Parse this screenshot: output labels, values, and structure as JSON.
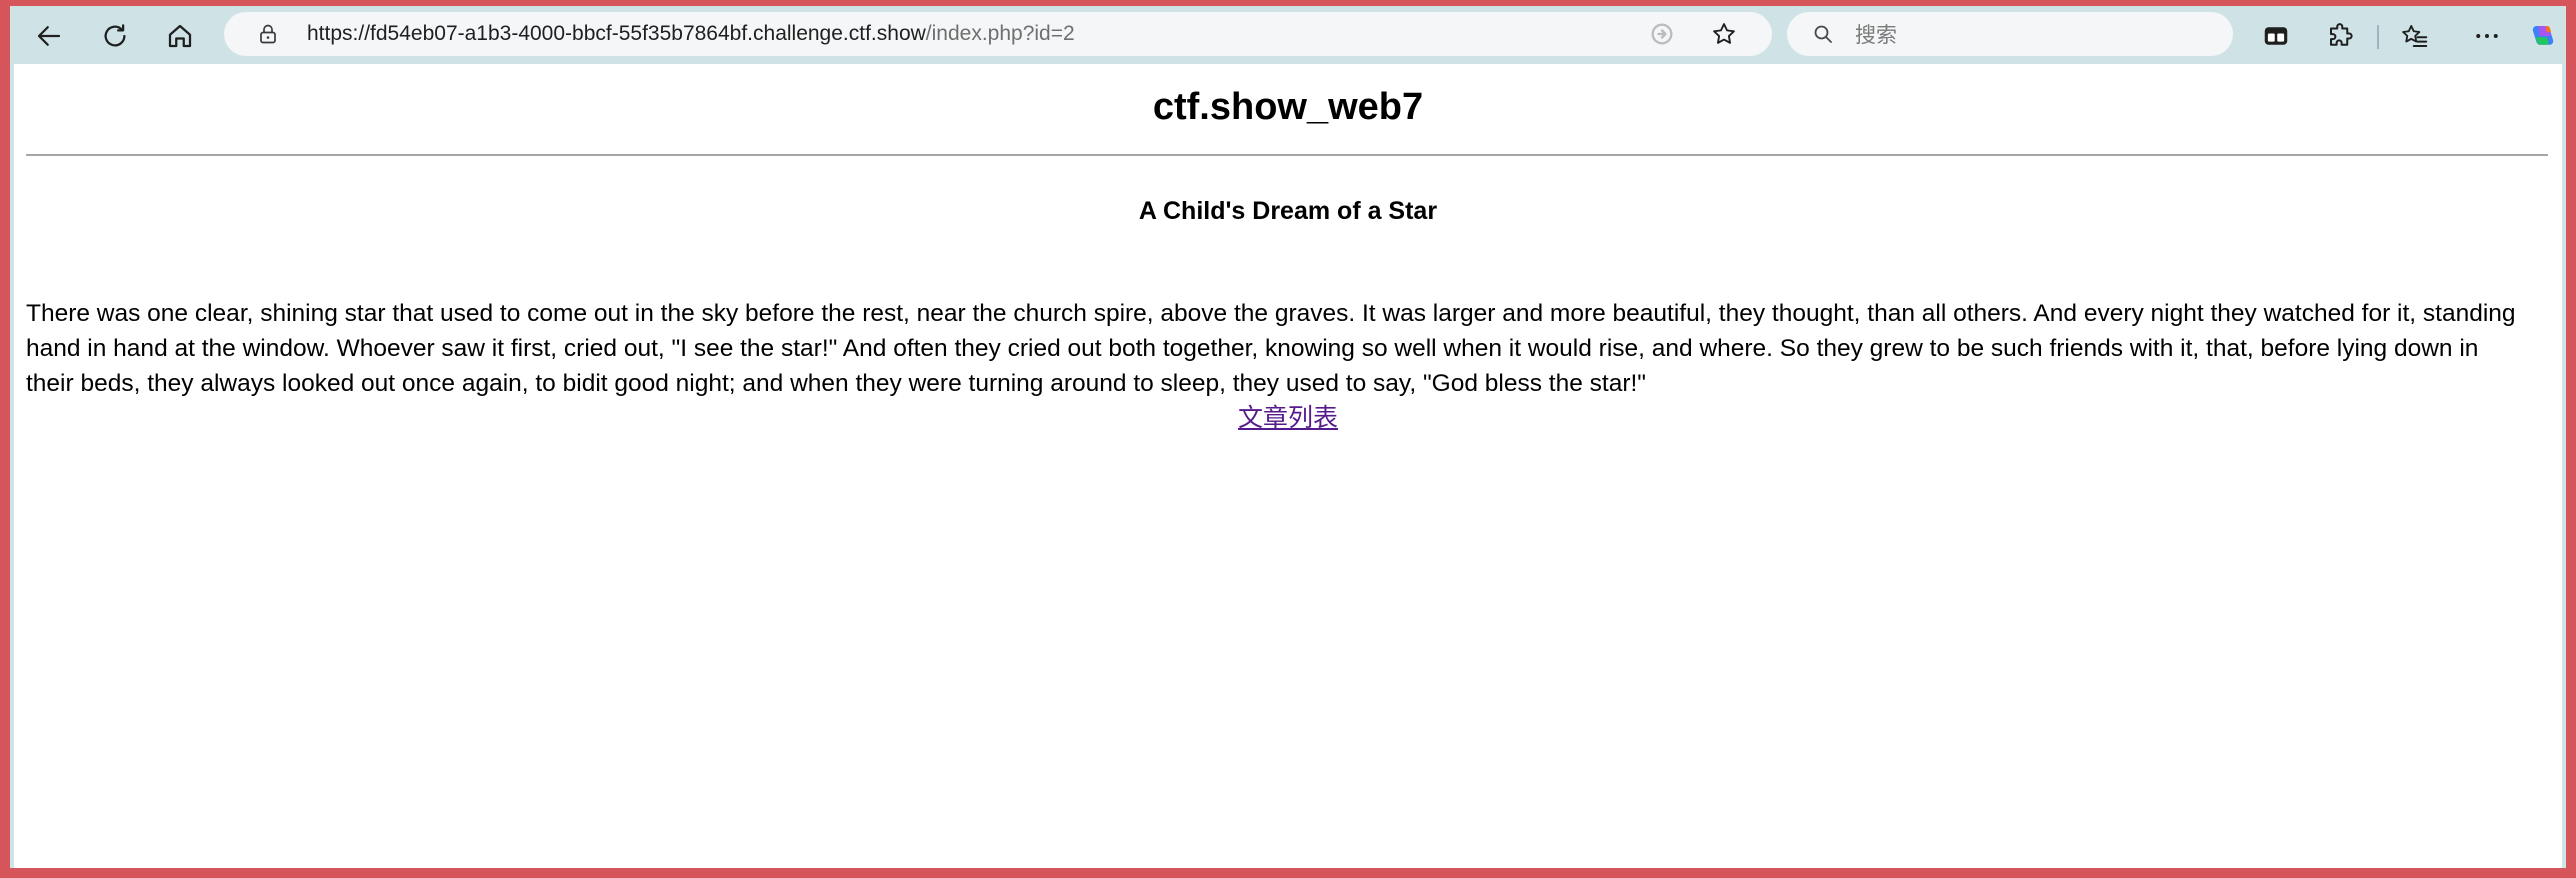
{
  "browser": {
    "url_host": "https://fd54eb07-a1b3-4000-bbcf-55f35b7864bf.challenge.ctf.show",
    "url_path": "/index.php?id=2",
    "search_placeholder": "搜索"
  },
  "icons": {
    "back": "back-arrow-icon",
    "refresh": "refresh-icon",
    "home": "home-icon",
    "site_info": "lock-icon",
    "read_aloud": "read-aloud-icon",
    "favorite": "star-icon",
    "search": "search-icon",
    "split_screen": "split-screen-icon",
    "extensions": "puzzle-icon",
    "favorites_hub": "favorites-list-icon",
    "menu": "more-icon",
    "copilot": "copilot-icon"
  },
  "colors": {
    "frame": "#d6555a",
    "toolbar": "#cfe3e7",
    "visited_link": "#551a8b"
  },
  "page": {
    "title": "ctf.show_web7",
    "article_title": "A Child's Dream of a Star",
    "article_body": "There was one clear, shining star that used to come out in the sky before the rest, near the church spire, above the graves. It was larger and more beautiful, they thought, than all others. And every night they watched for it, standing hand in hand at the window. Whoever saw it first, cried out, \"I see the star!\" And often they cried out both together, knowing so well when it would rise, and where. So they grew to be such friends with it, that, before lying down in their beds, they always looked out once again, to bidit good night; and when they were turning around to sleep, they used to say, \"God bless the star!\"",
    "link_label": "文章列表"
  }
}
